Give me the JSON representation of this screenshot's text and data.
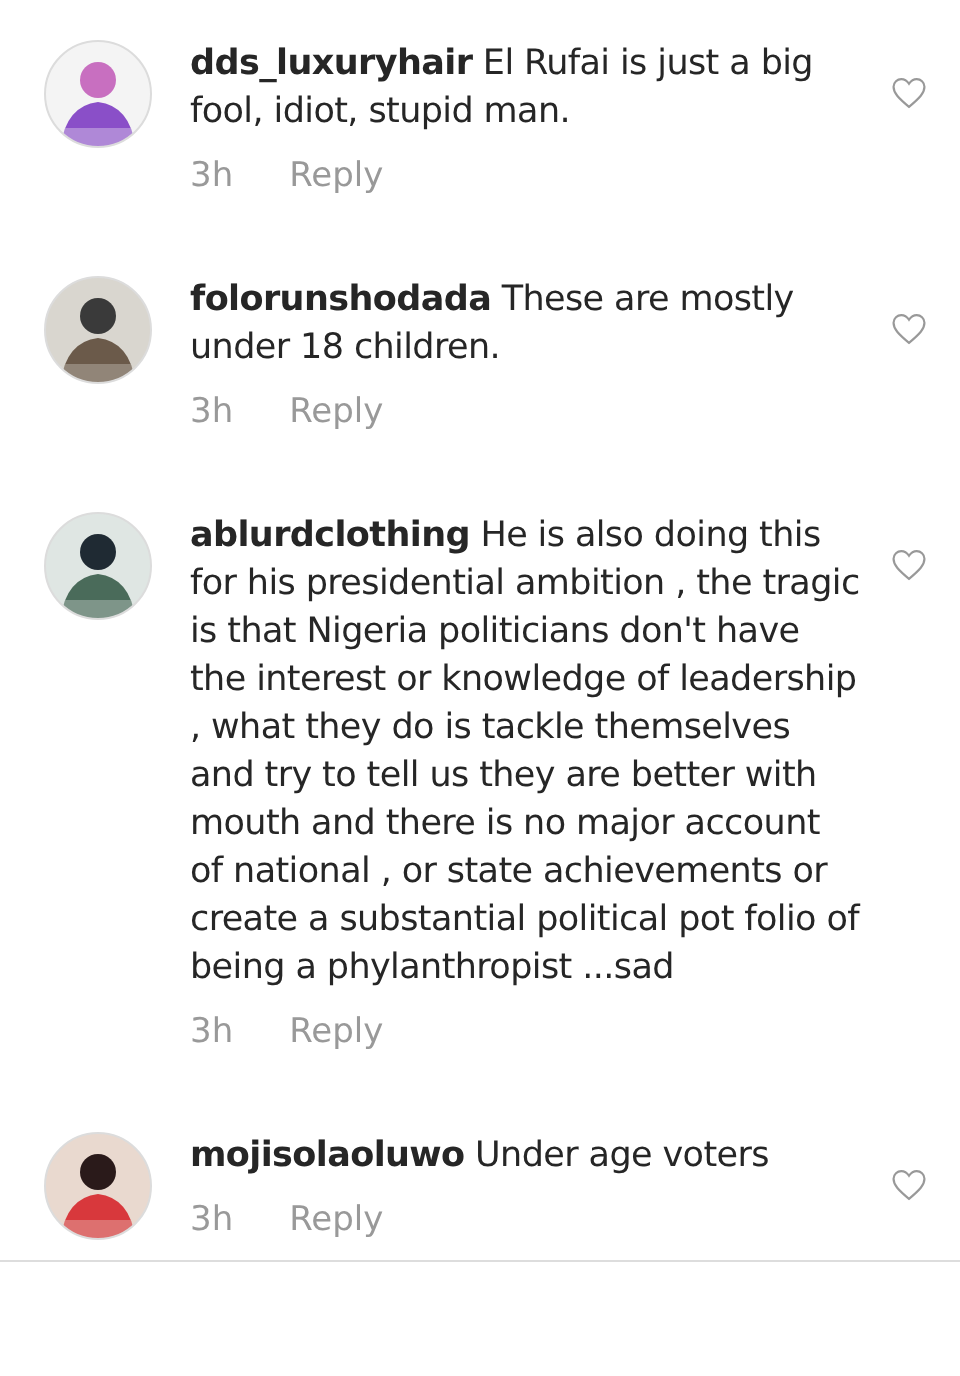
{
  "comments": [
    {
      "username": "dds_luxuryhair",
      "text": "El Rufai is just a big fool, idiot, stupid man.",
      "time": "3h",
      "reply": "Reply",
      "liked": false
    },
    {
      "username": "folorunshodada",
      "text": "These are mostly under 18 children.",
      "time": "3h",
      "reply": "Reply",
      "liked": false
    },
    {
      "username": "ablurdclothing",
      "text": "He is also doing this for his presidential ambition , the tragic is that Nigeria politicians don't have the interest or knowledge of leadership , what they do is tackle themselves and try to tell us they are better with mouth and there is no major account of national , or state achievements or create a substantial political pot folio of being a phylanthropist ...sad",
      "time": "3h",
      "reply": "Reply",
      "liked": false
    },
    {
      "username": "mojisolaoluwo",
      "text": "Under age voters",
      "time": "3h",
      "reply": "Reply",
      "liked": false
    }
  ]
}
